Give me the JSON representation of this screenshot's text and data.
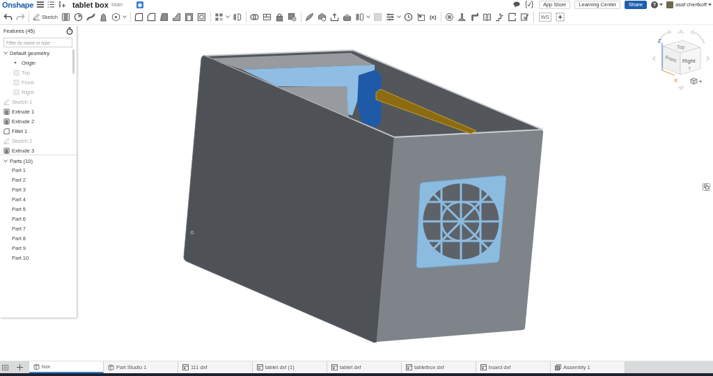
{
  "header": {
    "logo": "Onshape",
    "document_title": "tablet box",
    "workspace": "Main",
    "buttons": [
      {
        "label": "App Store",
        "kind": "plain"
      },
      {
        "label": "Learning Center",
        "kind": "plain"
      },
      {
        "label": "Share",
        "kind": "primary"
      }
    ],
    "help": "?",
    "user_name": "asaf chertkoff"
  },
  "toolbar": {
    "sketch": "Sketch",
    "variable_tool": "(x)",
    "workspace_tool": "WS"
  },
  "feature_panel": {
    "title": "Features (45)",
    "filter_placeholder": "Filter by name or type",
    "features": [
      {
        "label": "Default geometry",
        "kind": "folder",
        "expanded": true,
        "hidden": false,
        "children": [
          {
            "label": "Origin",
            "kind": "origin",
            "hidden": false
          },
          {
            "label": "Top",
            "kind": "plane",
            "hidden": true
          },
          {
            "label": "Front",
            "kind": "plane",
            "hidden": true
          },
          {
            "label": "Right",
            "kind": "plane",
            "hidden": true
          }
        ]
      },
      {
        "label": "Sketch 1",
        "kind": "sketch",
        "hidden": true
      },
      {
        "label": "Extrude 1",
        "kind": "extrude",
        "hidden": false
      },
      {
        "label": "Extrude 2",
        "kind": "extrude",
        "hidden": false
      },
      {
        "label": "Fillet 1",
        "kind": "fillet",
        "hidden": false
      },
      {
        "label": "Sketch 2",
        "kind": "sketch",
        "hidden": true
      },
      {
        "label": "Extrude 3",
        "kind": "extrude",
        "hidden": false
      }
    ],
    "parts_section": {
      "label": "Parts (10)",
      "expanded": true,
      "items": [
        "Part 1",
        "Part 2",
        "Part 3",
        "Part 4",
        "Part 5",
        "Part 6",
        "Part 7",
        "Part 8",
        "Part 9",
        "Part 10"
      ]
    }
  },
  "view_cube": {
    "faces": [
      "Top",
      "Front",
      "Right"
    ],
    "axes": [
      "Z",
      "X",
      "Y"
    ]
  },
  "tabs": [
    {
      "label": "box",
      "kind": "part_studio",
      "selected": true
    },
    {
      "label": "Part Studio 1",
      "kind": "part_studio",
      "selected": false
    },
    {
      "label": "111 dxf",
      "kind": "dxf",
      "selected": false
    },
    {
      "label": "tablet dxf (1)",
      "kind": "dxf",
      "selected": false
    },
    {
      "label": "tablet dxf",
      "kind": "dxf",
      "selected": false
    },
    {
      "label": "tabletbox dxf",
      "kind": "dxf",
      "selected": false
    },
    {
      "label": "board dxf",
      "kind": "dxf",
      "selected": false
    },
    {
      "label": "Assembly 1",
      "kind": "assembly",
      "selected": false
    }
  ]
}
